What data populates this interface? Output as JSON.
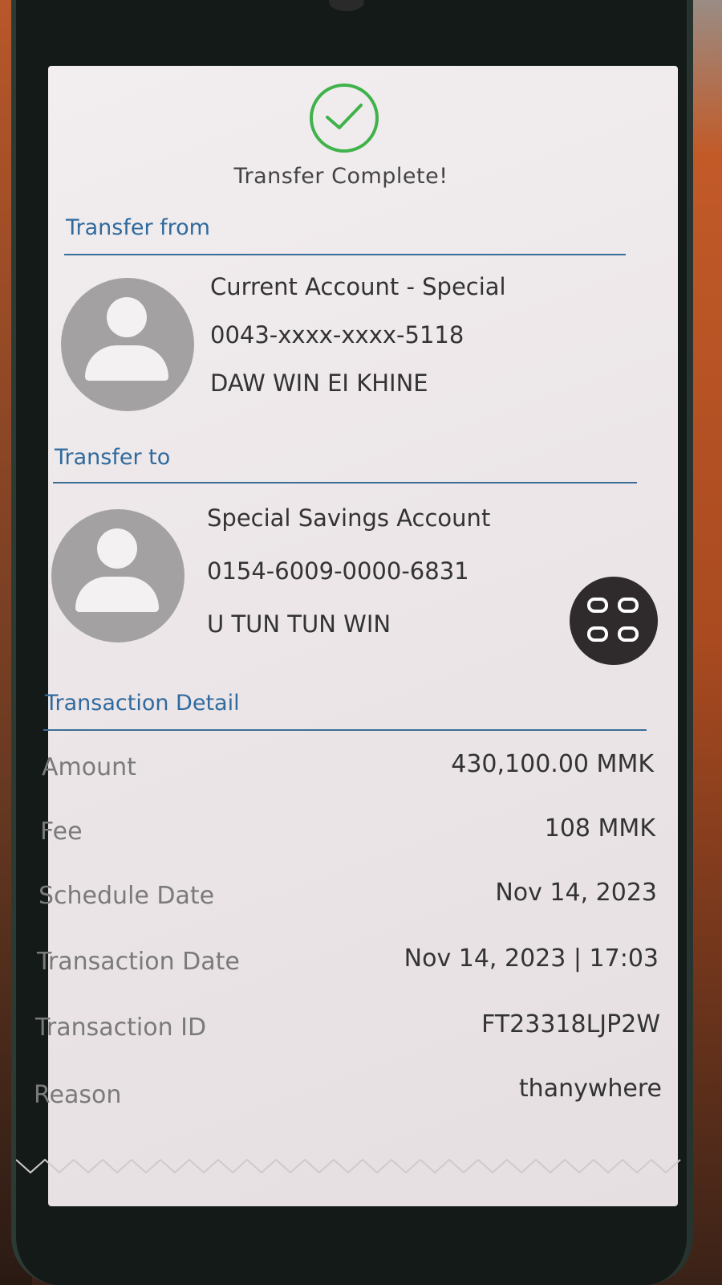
{
  "header": {
    "title": "Transfer Complete!"
  },
  "transfer_from": {
    "label": "Transfer from",
    "account_type": "Current Account - Special",
    "account_number": "0043-xxxx-xxxx-5118",
    "holder_name": "DAW WIN EI KHINE"
  },
  "transfer_to": {
    "label": "Transfer to",
    "account_type": "Special Savings Account",
    "account_number": "0154-6009-0000-6831",
    "holder_name": "U TUN TUN WIN"
  },
  "transaction": {
    "label": "Transaction Detail",
    "rows": [
      {
        "label": "Amount",
        "value": "430,100.00 MMK"
      },
      {
        "label": "Fee",
        "value": "108 MMK"
      },
      {
        "label": "Schedule Date",
        "value": "Nov 14, 2023"
      },
      {
        "label": "Transaction Date",
        "value": "Nov 14, 2023 | 17:03"
      },
      {
        "label": "Transaction ID",
        "value": "FT23318LJP2W"
      },
      {
        "label": "Reason",
        "value": "thanywhere"
      }
    ]
  },
  "icons": {
    "status": "check-circle-icon",
    "avatar": "person-avatar-icon",
    "menu": "app-grid-icon"
  },
  "colors": {
    "success": "#3fb24a",
    "section_label": "#2f6a9e",
    "screen_bg": "#efeaec"
  }
}
